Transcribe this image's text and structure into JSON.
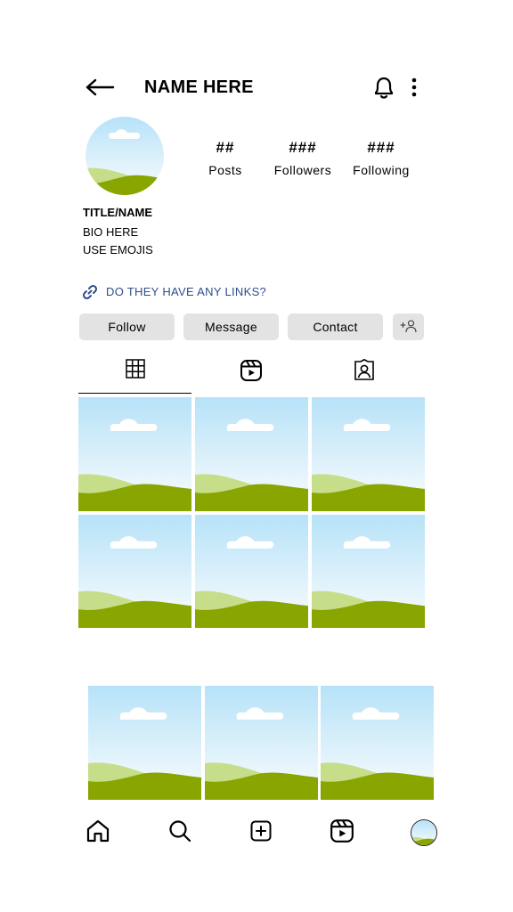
{
  "header": {
    "title": "NAME HERE",
    "back_icon": "arrow-left-icon",
    "notification_icon": "bell-icon",
    "more_icon": "more-vertical-icon"
  },
  "stats": {
    "posts": {
      "value": "##",
      "label": "Posts"
    },
    "followers": {
      "value": "###",
      "label": "Followers"
    },
    "following": {
      "value": "###",
      "label": "Following"
    }
  },
  "bio": {
    "name": "TITLE/NAME",
    "lines": [
      "BIO HERE",
      "USE EMOJIS"
    ]
  },
  "link": {
    "text": "DO THEY HAVE ANY LINKS?",
    "icon": "link-icon",
    "color": "#2e4e8e"
  },
  "actions": {
    "follow": "Follow",
    "message": "Message",
    "contact": "Contact",
    "add_user_icon": "add-user-icon"
  },
  "tabs": [
    {
      "icon": "grid-icon",
      "active": true
    },
    {
      "icon": "reels-icon",
      "active": false
    },
    {
      "icon": "tagged-icon",
      "active": false
    }
  ],
  "bottom_nav": [
    {
      "icon": "home-icon"
    },
    {
      "icon": "search-icon"
    },
    {
      "icon": "create-icon"
    },
    {
      "icon": "reels-icon"
    },
    {
      "icon": "profile-avatar"
    }
  ],
  "colors": {
    "sky_top": "#b6e2f8",
    "sky_bottom": "#ffffff",
    "hill_light": "#c6dd8a",
    "hill_dark": "#88a500",
    "button_bg": "#e3e3e3"
  }
}
